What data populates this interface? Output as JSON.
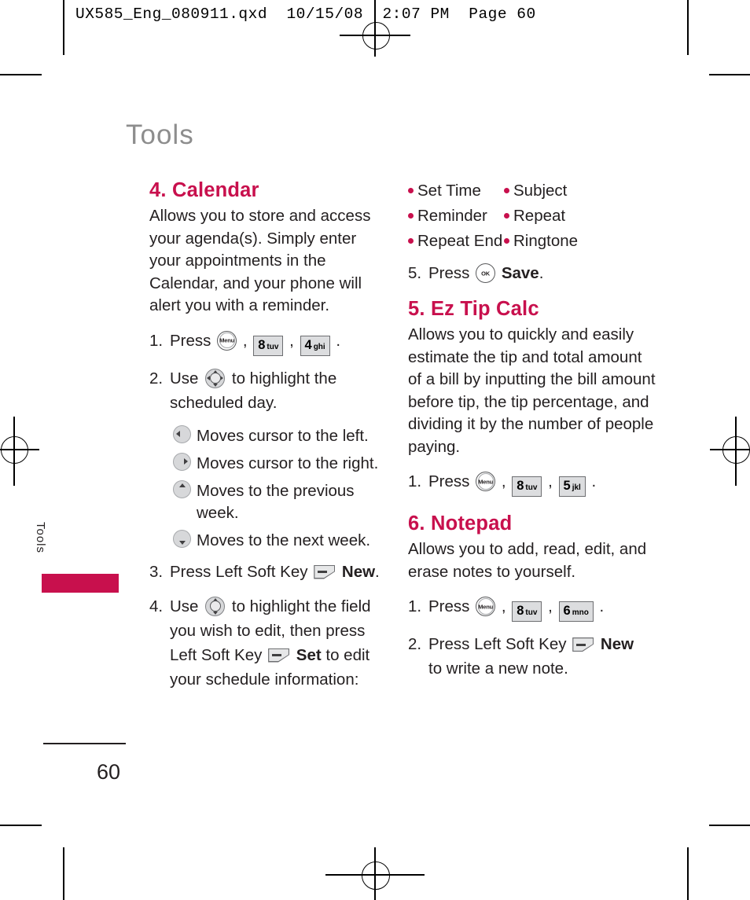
{
  "prepress_header": "UX585_Eng_080911.qxd  10/15/08  2:07 PM  Page 60",
  "page_title": "Tools",
  "side_tab": {
    "label": "Tools",
    "color": "#c8104d"
  },
  "footer": {
    "page_number": "60"
  },
  "accent_color": "#c8104d",
  "left_column": {
    "section": {
      "heading": "4. Calendar",
      "intro": "Allows you to store and access your agenda(s). Simply enter your appointments in the Calendar, and your phone will alert you with a reminder."
    },
    "steps": {
      "s1_num": "1.",
      "s1_press": "Press",
      "s1_comma1": ",",
      "s1_comma2": ",",
      "s1_period": ".",
      "s2_num": "2.",
      "s2_use": "Use",
      "s2_text": "to highlight the",
      "s2_cont": "scheduled day.",
      "s3_num": "3.",
      "s3_text": "Press Left Soft Key",
      "s3_label": "New",
      "s3_period": ".",
      "s4_num": "4.",
      "s4_use": "Use",
      "s4_text": "to highlight the field",
      "s4_cont1": "you wish to edit, then press",
      "s4_cont2_pre": "Left Soft Key",
      "s4_label": "Set",
      "s4_cont2_post": "to edit",
      "s4_cont3": "your schedule information:"
    },
    "dir_keys": [
      {
        "dir": "left",
        "text": "Moves cursor to the left."
      },
      {
        "dir": "right",
        "text": "Moves cursor to the right."
      },
      {
        "dir": "up",
        "text": "Moves to the previous",
        "cont": "week."
      },
      {
        "dir": "down",
        "text": "Moves to the next week."
      }
    ],
    "keys": {
      "menu": "Menu",
      "k8_num": "8",
      "k8_letters": "tuv",
      "k4_num": "4",
      "k4_letters": "ghi"
    }
  },
  "right_column": {
    "field_bullets": [
      "Set Time",
      "Subject",
      "Reminder",
      "Repeat",
      "Repeat End",
      "Ringtone"
    ],
    "save_step": {
      "num": "5.",
      "press": "Press",
      "ok": "OK",
      "label": "Save",
      "period": "."
    },
    "section5": {
      "heading": "5. Ez Tip Calc",
      "intro": "Allows you to quickly and easily estimate the tip and total amount of a bill by inputting the bill amount before tip, the tip percentage, and dividing it by the number of people paying.",
      "step_num": "1.",
      "step_press": "Press",
      "comma1": ",",
      "comma2": ",",
      "period": ".",
      "menu": "Menu",
      "k8_num": "8",
      "k8_letters": "tuv",
      "k5_num": "5",
      "k5_letters": "jkl"
    },
    "section6": {
      "heading": "6. Notepad",
      "intro": "Allows you to add, read, edit, and erase notes to yourself.",
      "step1_num": "1.",
      "step1_press": "Press",
      "comma1": ",",
      "comma2": ",",
      "period": ".",
      "menu": "Menu",
      "k8_num": "8",
      "k8_letters": "tuv",
      "k6_num": "6",
      "k6_letters": "mno",
      "step2_num": "2.",
      "step2_text": "Press Left Soft Key",
      "step2_label": "New",
      "step2_cont": "to write a new note."
    }
  }
}
